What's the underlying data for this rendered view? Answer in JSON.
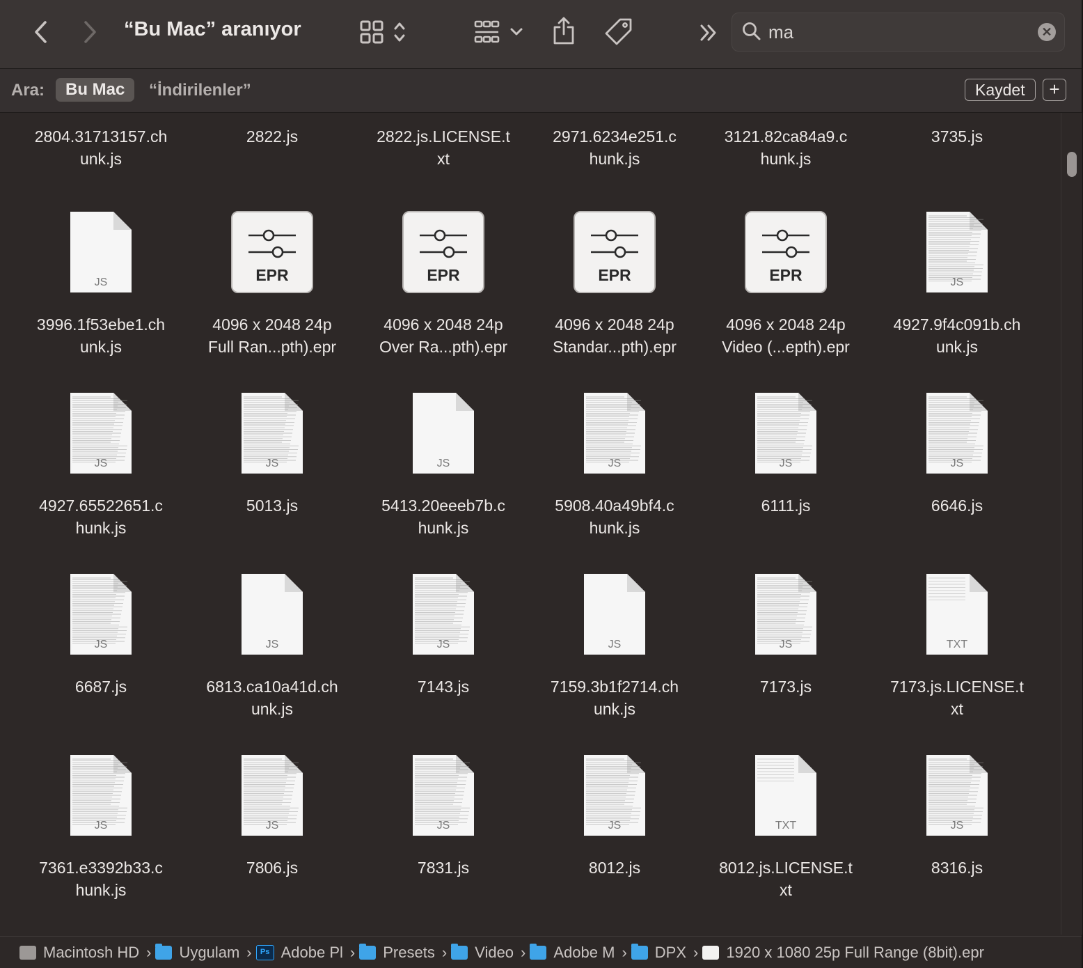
{
  "toolbar": {
    "title": "“Bu Mac” aranıyor",
    "search_value": "ma",
    "icons": [
      "back-icon",
      "forward-icon",
      "grid-view-icon",
      "sort-chevrons-icon",
      "group-icon",
      "chevron-down-icon",
      "share-icon",
      "tag-icon",
      "more-icon",
      "search-icon",
      "clear-icon"
    ]
  },
  "scope": {
    "label": "Ara:",
    "selected": "Bu Mac",
    "other": "“İndirilenler”",
    "save": "Kaydet",
    "add": "+"
  },
  "rows": [
    [
      {
        "name": "2804.31713157.ch\nunk.js",
        "icon": "none"
      },
      {
        "name": "2822.js",
        "icon": "none"
      },
      {
        "name": "2822.js.LICENSE.t\nxt",
        "icon": "none"
      },
      {
        "name": "2971.6234e251.c\nhunk.js",
        "icon": "none"
      },
      {
        "name": "3121.82ca84a9.c\nhunk.js",
        "icon": "none"
      },
      {
        "name": "3735.js",
        "icon": "none"
      }
    ],
    [
      {
        "name": "3996.1f53ebe1.ch\nunk.js",
        "icon": "js-plain",
        "label": "JS"
      },
      {
        "name": "4096 x 2048 24p\nFull Ran...pth).epr",
        "icon": "epr",
        "label": "EPR"
      },
      {
        "name": "4096 x 2048 24p\nOver Ra...pth).epr",
        "icon": "epr",
        "label": "EPR"
      },
      {
        "name": "4096 x 2048 24p\nStandar...pth).epr",
        "icon": "epr",
        "label": "EPR"
      },
      {
        "name": "4096 x 2048 24p\nVideo (...epth).epr",
        "icon": "epr",
        "label": "EPR"
      },
      {
        "name": "4927.9f4c091b.ch\nunk.js",
        "icon": "js-text",
        "label": "JS"
      }
    ],
    [
      {
        "name": "4927.65522651.c\nhunk.js",
        "icon": "js-text",
        "label": "JS"
      },
      {
        "name": "5013.js",
        "icon": "js-text",
        "label": "JS"
      },
      {
        "name": "5413.20eeeb7b.c\nhunk.js",
        "icon": "js-plain",
        "label": "JS"
      },
      {
        "name": "5908.40a49bf4.c\nhunk.js",
        "icon": "js-text",
        "label": "JS"
      },
      {
        "name": "6111.js",
        "icon": "js-text",
        "label": "JS"
      },
      {
        "name": "6646.js",
        "icon": "js-text",
        "label": "JS"
      }
    ],
    [
      {
        "name": "6687.js",
        "icon": "js-text",
        "label": "JS"
      },
      {
        "name": "6813.ca10a41d.ch\nunk.js",
        "icon": "js-plain",
        "label": "JS"
      },
      {
        "name": "7143.js",
        "icon": "js-text",
        "label": "JS"
      },
      {
        "name": "7159.3b1f2714.ch\nunk.js",
        "icon": "js-plain",
        "label": "JS"
      },
      {
        "name": "7173.js",
        "icon": "js-text",
        "label": "JS"
      },
      {
        "name": "7173.js.LICENSE.t\nxt",
        "icon": "txt-text",
        "label": "TXT"
      }
    ],
    [
      {
        "name": "7361.e3392b33.c\nhunk.js",
        "icon": "js-text",
        "label": "JS"
      },
      {
        "name": "7806.js",
        "icon": "js-text",
        "label": "JS"
      },
      {
        "name": "7831.js",
        "icon": "js-text",
        "label": "JS"
      },
      {
        "name": "8012.js",
        "icon": "js-text",
        "label": "JS"
      },
      {
        "name": "8012.js.LICENSE.t\nxt",
        "icon": "txt-text",
        "label": "TXT"
      },
      {
        "name": "8316.js",
        "icon": "js-text",
        "label": "JS"
      }
    ]
  ],
  "pathbar": [
    {
      "label": "Macintosh HD",
      "icon": "disk-icon"
    },
    {
      "label": "Uygulam",
      "icon": "apps-folder-icon"
    },
    {
      "label": "Adobe Pl",
      "icon": "photoshop-icon"
    },
    {
      "label": "Presets",
      "icon": "folder-icon"
    },
    {
      "label": "Video",
      "icon": "folder-icon"
    },
    {
      "label": "Adobe M",
      "icon": "folder-icon"
    },
    {
      "label": "DPX",
      "icon": "folder-icon"
    },
    {
      "label": "1920 x 1080 25p Full Range (8bit).epr",
      "icon": "epr-file-icon"
    }
  ],
  "colors": {
    "accent": "#3fa4e8",
    "background": "#2d2827"
  }
}
